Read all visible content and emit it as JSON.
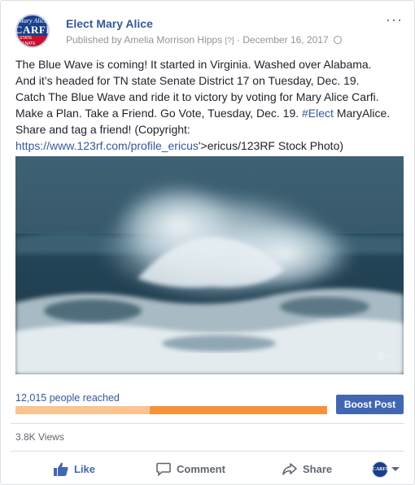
{
  "post": {
    "page_name": "Elect Mary Alice",
    "byline_prefix": "Published by",
    "author": "Amelia Morrison Hipps",
    "help_mark": "[?]",
    "separator": "·",
    "date": "December 16, 2017",
    "more_label": "···",
    "avatar": {
      "top_text": "Mary Alice",
      "main_text": "CARFI",
      "tag_text": "STATE SENATE"
    },
    "text_lines": [
      "The Blue Wave is coming! It started in Virginia. Washed over Alabama.",
      "And it’s headed for TN state Senate District 17 on Tuesday, Dec. 19.",
      "Catch The Blue Wave and ride it to victory by voting for Mary Alice Carfi.",
      "Make a Plan. Take a Friend. Go Vote, Tuesday, Dec. 19."
    ],
    "hashtag": "#Elect",
    "line4_tail": " MaryAlice.",
    "line5": "Share and tag a friend! (Copyright:",
    "link_url": "https://www.123rf.com/profile_ericus",
    "link_tail": "'>ericus/123RF Stock Photo)"
  },
  "media": {
    "type": "video",
    "mute_icon": "speaker-muted-icon"
  },
  "insights": {
    "reached_text": "12,015 people reached",
    "organic_fraction": 0.43,
    "boost_label": "Boost Post",
    "views_text": "3.8K Views"
  },
  "actions": {
    "like": "Like",
    "comment": "Comment",
    "share": "Share"
  },
  "colors": {
    "brand_blue": "#4267b2",
    "link_blue": "#365899",
    "paid_orange": "#f7923a",
    "organic_orange": "#fbc38f"
  }
}
